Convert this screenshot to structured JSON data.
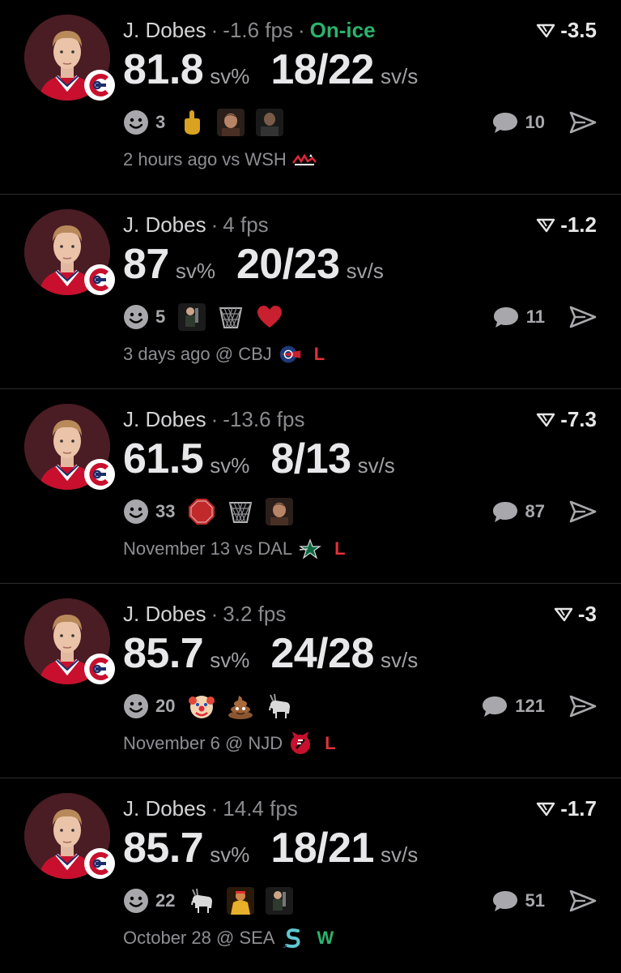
{
  "posts": [
    {
      "player": "J. Dobes",
      "fps": "-1.6 fps",
      "status": "On-ice",
      "delta": "-3.5",
      "save_pct": "81.8",
      "save_pct_unit": "sv%",
      "saves": "18/22",
      "saves_unit": "sv/s",
      "smiley_count": "3",
      "reactions": [
        "middle-finger-icon",
        "face-gif-icon",
        "man-gif-icon"
      ],
      "comment_count": "10",
      "time": "2 hours ago vs WSH",
      "opponent_logo": "capitals-logo",
      "result": ""
    },
    {
      "player": "J. Dobes",
      "fps": "4 fps",
      "status": "",
      "delta": "-1.2",
      "save_pct": "87",
      "save_pct_unit": "sv%",
      "saves": "20/23",
      "saves_unit": "sv/s",
      "smiley_count": "5",
      "reactions": [
        "player-gif-icon",
        "basket-icon",
        "heart-icon"
      ],
      "comment_count": "11",
      "time": "3 days ago @ CBJ",
      "opponent_logo": "blue-jackets-logo",
      "result": "L"
    },
    {
      "player": "J. Dobes",
      "fps": "-13.6 fps",
      "status": "",
      "delta": "-7.3",
      "save_pct": "61.5",
      "save_pct_unit": "sv%",
      "saves": "8/13",
      "saves_unit": "sv/s",
      "smiley_count": "33",
      "reactions": [
        "stop-sign-icon",
        "basket-icon",
        "face-gif-icon"
      ],
      "comment_count": "87",
      "time": "November 13 vs DAL",
      "opponent_logo": "stars-logo",
      "result": "L"
    },
    {
      "player": "J. Dobes",
      "fps": "3.2 fps",
      "status": "",
      "delta": "-3",
      "save_pct": "85.7",
      "save_pct_unit": "sv%",
      "saves": "24/28",
      "saves_unit": "sv/s",
      "smiley_count": "20",
      "reactions": [
        "clown-icon",
        "poop-icon",
        "goat-icon"
      ],
      "comment_count": "121",
      "time": "November 6 @ NJD",
      "opponent_logo": "devils-logo",
      "result": "L"
    },
    {
      "player": "J. Dobes",
      "fps": "14.4 fps",
      "status": "",
      "delta": "-1.7",
      "save_pct": "85.7",
      "save_pct_unit": "sv%",
      "saves": "18/21",
      "saves_unit": "sv/s",
      "smiley_count": "22",
      "reactions": [
        "goat-icon",
        "wrestler-gif-icon",
        "player-gif-icon"
      ],
      "comment_count": "51",
      "time": "October 28 @ SEA",
      "opponent_logo": "kraken-logo",
      "result": "W"
    }
  ],
  "colors": {
    "background": "#000000",
    "on_ice": "#2bb36d",
    "loss": "#e0323a",
    "win": "#2bb36d",
    "avatar_bg": "#4a1c23"
  }
}
